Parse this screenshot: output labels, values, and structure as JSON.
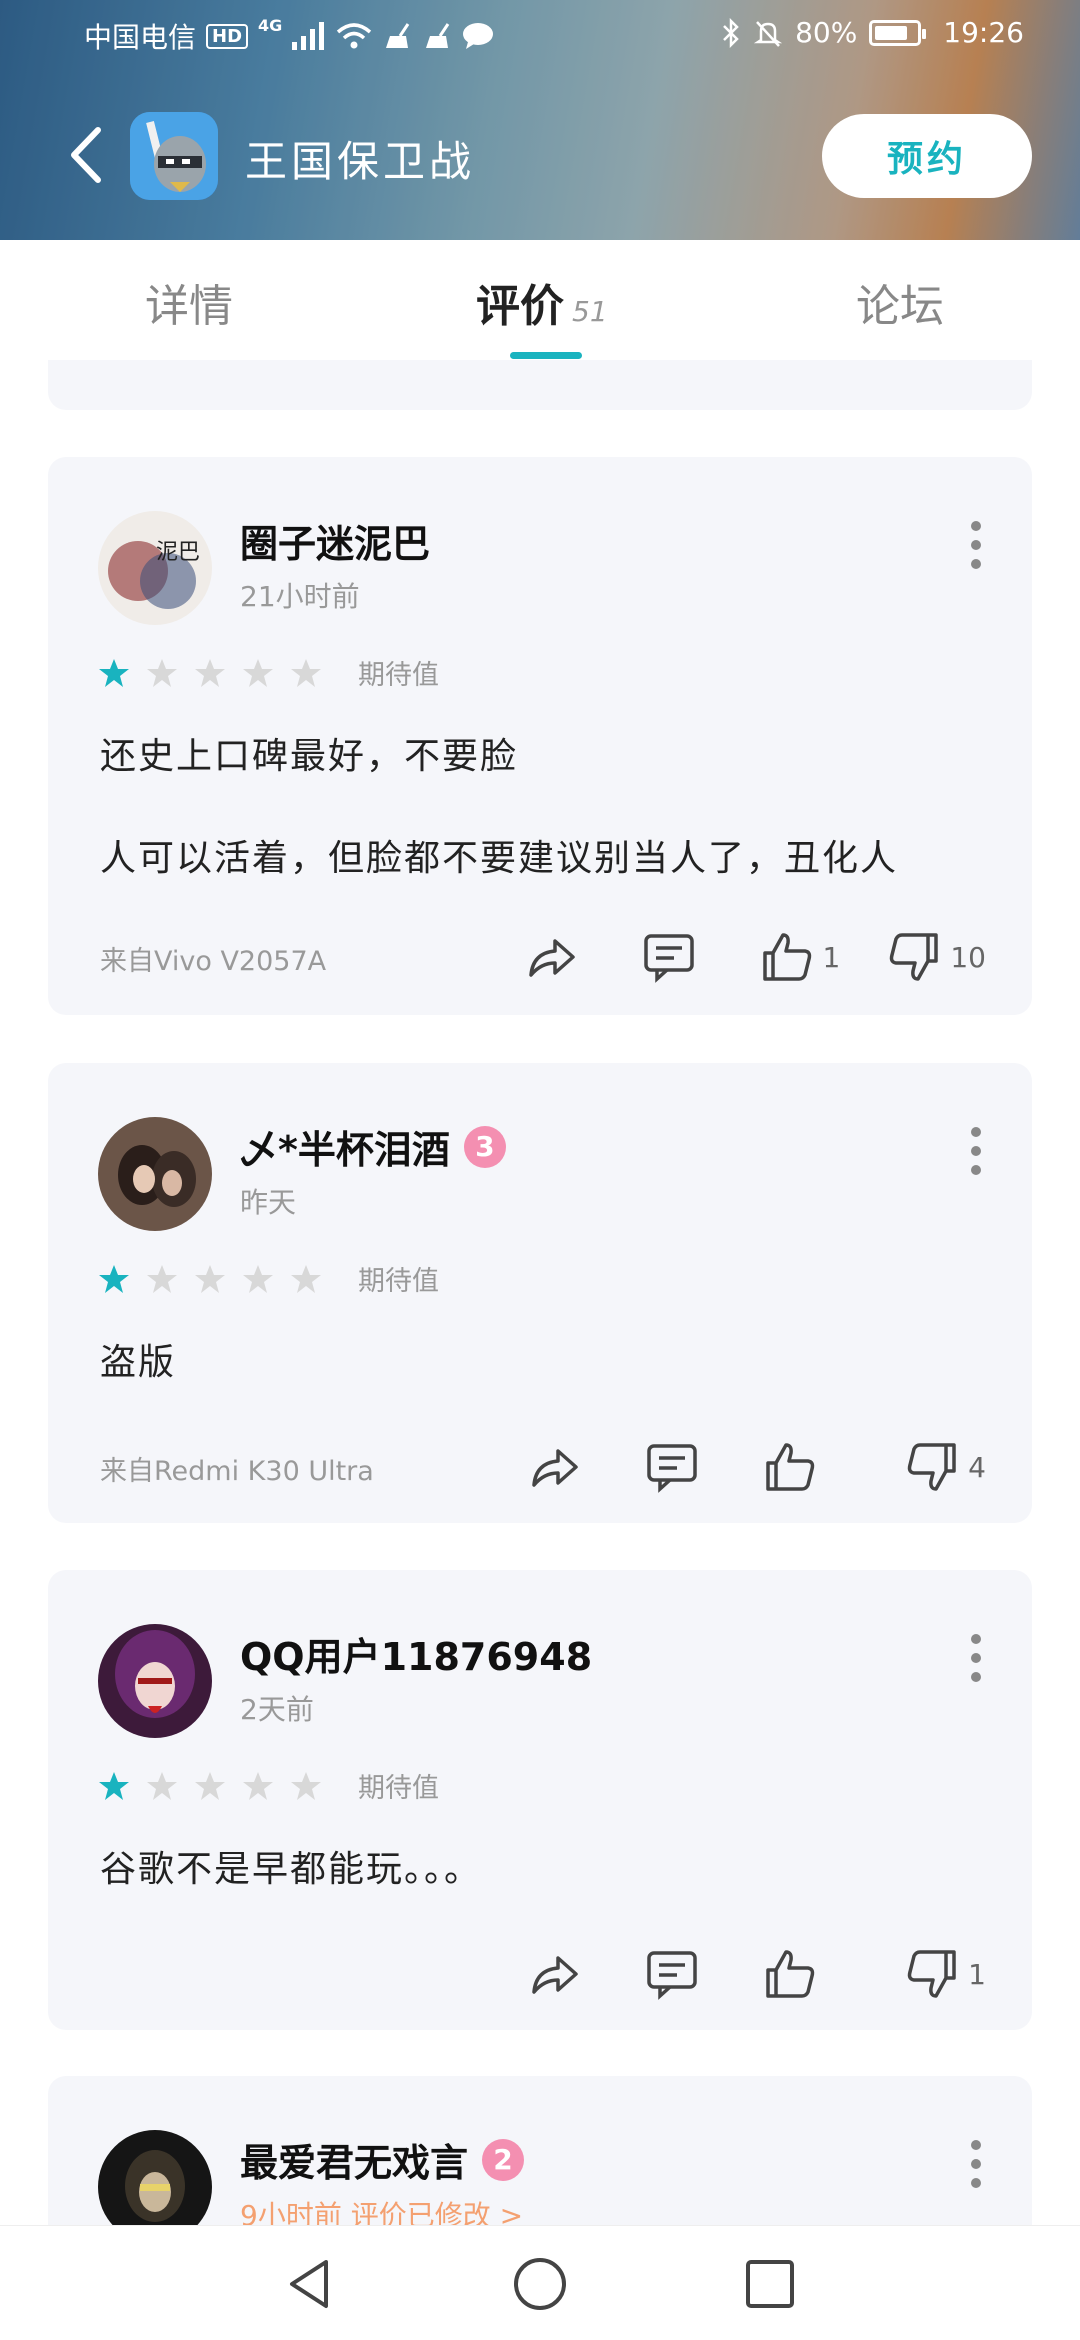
{
  "status_bar": {
    "carrier": "中国电信",
    "hd": "HD",
    "network": "4G",
    "battery": "80%",
    "battery_level": 0.8,
    "time": "19:26"
  },
  "header": {
    "app_title": "王国保卫战",
    "reserve_label": "预约"
  },
  "tabs": [
    {
      "label": "详情"
    },
    {
      "label": "评价",
      "count": "51"
    },
    {
      "label": "论坛"
    }
  ],
  "rating_label": "期待值",
  "reviews": [
    {
      "username": "圈子迷泥巴",
      "time": "21小时前",
      "stars": 1,
      "lines": [
        "还史上口碑最好，不要脸",
        "人可以活着，但脸都不要建议别当人了，丑化人"
      ],
      "device": "来自Vivo V2057A",
      "likes": "1",
      "dislikes": "10",
      "avatar_text": "泥巴"
    },
    {
      "username": "乄*半杯泪酒",
      "level": "3",
      "time": "昨天",
      "stars": 1,
      "lines": [
        "盗版"
      ],
      "device": "来自Redmi K30 Ultra",
      "likes": "",
      "dislikes": "4"
    },
    {
      "username": "QQ用户11876948",
      "time": "2天前",
      "stars": 1,
      "lines": [
        "谷歌不是早都能玩。。。"
      ],
      "device": "",
      "likes": "",
      "dislikes": "1"
    },
    {
      "username": "最爱君无戏言",
      "level": "2",
      "time": "9小时前 评价已修改 >"
    }
  ],
  "colors": {
    "accent": "#19b3bf",
    "star_on": "#19b3bf",
    "star_off": "#d8d8d8",
    "card_bg": "#f5f6fa"
  }
}
